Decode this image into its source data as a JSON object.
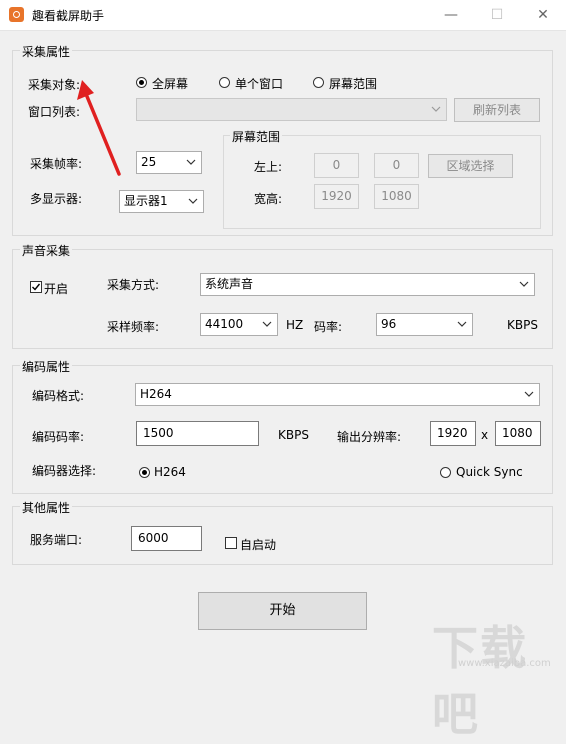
{
  "window": {
    "title": "趣看截屏助手",
    "minimize": "—",
    "maximize": "☐",
    "close": "✕"
  },
  "capture": {
    "section_title": "采集属性",
    "target_label": "采集对象:",
    "target_options": [
      "全屏幕",
      "单个窗口",
      "屏幕范围"
    ],
    "target_selected": 0,
    "window_list_label": "窗口列表:",
    "window_list_value": "",
    "refresh_button": "刷新列表",
    "framerate_label": "采集帧率:",
    "framerate_value": "25",
    "monitor_label": "多显示器:",
    "monitor_value": "显示器1",
    "screen_range": {
      "title": "屏幕范围",
      "topleft_label": "左上:",
      "x": "0",
      "y": "0",
      "region_button": "区域选择",
      "size_label": "宽高:",
      "width": "1920",
      "height": "1080"
    }
  },
  "audio": {
    "section_title": "声音采集",
    "enable_label": "开启",
    "enabled": true,
    "mode_label": "采集方式:",
    "mode_value": "系统声音",
    "samplerate_label": "采样频率:",
    "samplerate_value": "44100",
    "samplerate_unit": "HZ",
    "bitrate_label": "码率:",
    "bitrate_value": "96",
    "bitrate_unit": "KBPS"
  },
  "encode": {
    "section_title": "编码属性",
    "format_label": "编码格式:",
    "format_value": "H264",
    "bitrate_label": "编码码率:",
    "bitrate_value": "1500",
    "bitrate_unit": "KBPS",
    "resolution_label": "输出分辨率:",
    "res_width": "1920",
    "res_sep": "x",
    "res_height": "1080",
    "encoder_label": "编码器选择:",
    "encoder_options": [
      "H264",
      "Quick Sync"
    ],
    "encoder_selected": 0
  },
  "other": {
    "section_title": "其他属性",
    "port_label": "服务端口:",
    "port_value": "6000",
    "autostart_label": "自启动",
    "autostart": false
  },
  "start_button": "开始",
  "watermark": {
    "logo": "下载吧",
    "url": "www.xiazaiba.com"
  },
  "colors": {
    "annotation_arrow": "#e02020",
    "app_icon": "#e8742a"
  }
}
